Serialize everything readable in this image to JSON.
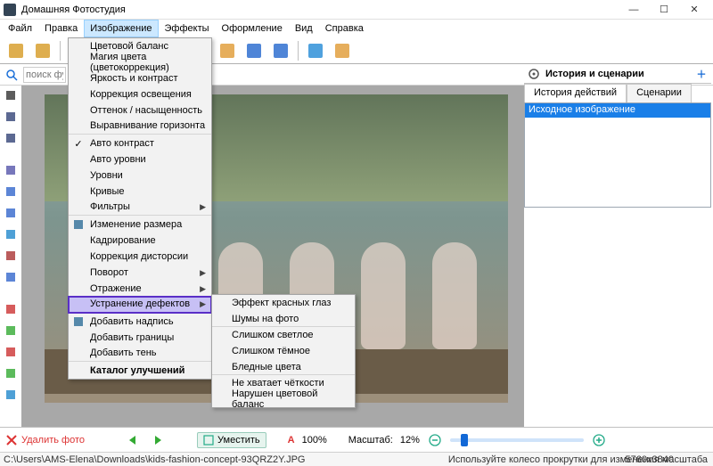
{
  "app": {
    "title": "Домашняя Фотостудия"
  },
  "window_controls": {
    "min": "—",
    "max": "☐",
    "close": "✕"
  },
  "menubar": {
    "items": [
      "Файл",
      "Правка",
      "Изображение",
      "Эффекты",
      "Оформление",
      "Вид",
      "Справка"
    ],
    "open_index": 2
  },
  "search": {
    "placeholder": "поиск фу"
  },
  "dropdown": {
    "groups": [
      {
        "items": [
          {
            "label": "Цветовой баланс"
          },
          {
            "label": "Магия цвета (цветокоррекция)"
          },
          {
            "label": "Яркость и контраст"
          },
          {
            "label": "Коррекция освещения"
          },
          {
            "label": "Оттенок / насыщенность"
          },
          {
            "label": "Выравнивание горизонта"
          }
        ]
      },
      {
        "items": [
          {
            "label": "Авто контраст",
            "check": true
          },
          {
            "label": "Авто уровни"
          },
          {
            "label": "Уровни"
          },
          {
            "label": "Кривые"
          },
          {
            "label": "Фильтры",
            "submenu": true
          }
        ]
      },
      {
        "items": [
          {
            "label": "Изменение размера",
            "icon": "resize"
          },
          {
            "label": "Кадрирование"
          },
          {
            "label": "Коррекция дисторсии"
          },
          {
            "label": "Поворот",
            "submenu": true
          },
          {
            "label": "Отражение",
            "submenu": true
          },
          {
            "label": "Устранение дефектов",
            "submenu": true,
            "highlight": true
          }
        ]
      },
      {
        "items": [
          {
            "label": "Добавить надпись",
            "icon": "text"
          },
          {
            "label": "Добавить границы"
          },
          {
            "label": "Добавить тень"
          }
        ]
      },
      {
        "items": [
          {
            "label": "Каталог улучшений",
            "bold": true
          }
        ]
      }
    ]
  },
  "submenu": {
    "items": [
      {
        "label": "Эффект красных глаз"
      },
      {
        "label": "Шумы на фото",
        "sep": true
      },
      {
        "label": "Слишком светлое"
      },
      {
        "label": "Слишком тёмное"
      },
      {
        "label": "Бледные цвета",
        "sep": true
      },
      {
        "label": "Не хватает чёткости"
      },
      {
        "label": "Нарушен цветовой баланс"
      }
    ]
  },
  "right_panel": {
    "title": "История и сценарии",
    "tabs": [
      "История действий",
      "Сценарии"
    ],
    "active_tab": 0,
    "history": [
      "Исходное изображение"
    ]
  },
  "bottom": {
    "delete": "Удалить фото",
    "fit": "Уместить",
    "zoom_text_label": "A",
    "zoom_text_value": "100%",
    "scale_label": "Масштаб:",
    "scale_value": "12%"
  },
  "status": {
    "path": "C:\\Users\\AMS-Elena\\Downloads\\kids-fashion-concept-93QRZ2Y.JPG",
    "dimensions": "5760x3840",
    "hint": "Используйте колесо прокрутки для изменения масштаба"
  },
  "left_tools": [
    "pointer",
    "hand",
    "zoom",
    "eyedrop",
    "drop1",
    "drop2",
    "triangle",
    "square",
    "circle",
    "rgb",
    "color",
    "layers",
    "fx",
    "crop"
  ],
  "toolbar_icons": [
    "open",
    "save",
    "undo",
    "redo",
    "text",
    "palette",
    "frame1",
    "frame2",
    "calendar",
    "grid",
    "help",
    "info"
  ]
}
